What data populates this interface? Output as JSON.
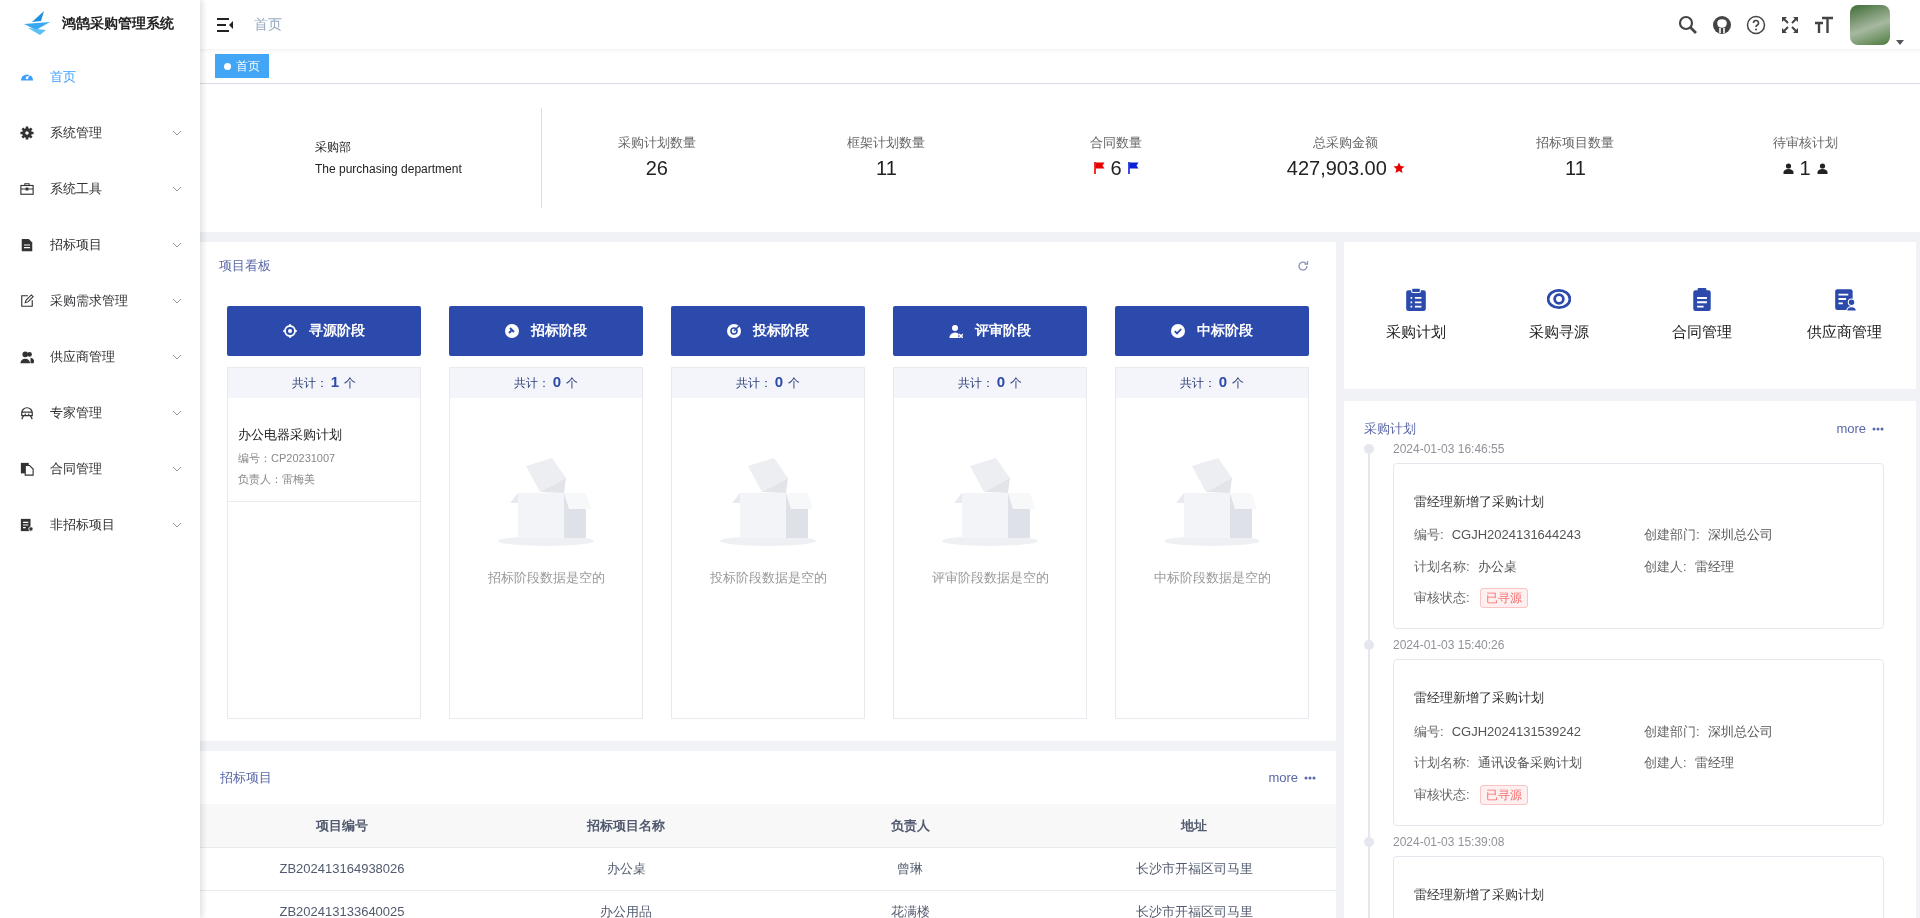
{
  "sidebar": {
    "logo_text": "鸿鹄采购管理系统",
    "items": [
      {
        "label": "首页",
        "selected": true,
        "expandable": false
      },
      {
        "label": "系统管理",
        "selected": false,
        "expandable": true
      },
      {
        "label": "系统工具",
        "selected": false,
        "expandable": true
      },
      {
        "label": "招标项目",
        "selected": false,
        "expandable": true
      },
      {
        "label": "采购需求管理",
        "selected": false,
        "expandable": true
      },
      {
        "label": "供应商管理",
        "selected": false,
        "expandable": true
      },
      {
        "label": "专家管理",
        "selected": false,
        "expandable": true
      },
      {
        "label": "合同管理",
        "selected": false,
        "expandable": true
      },
      {
        "label": "非招标项目",
        "selected": false,
        "expandable": true
      }
    ]
  },
  "header": {
    "breadcrumb": "首页"
  },
  "tags": [
    {
      "label": "首页",
      "selected": true
    }
  ],
  "stats": {
    "department": {
      "title": "采购部",
      "subtitle": "The purchasing department"
    },
    "items": [
      {
        "label": "采购计划数量",
        "value": "26",
        "kind": "plain"
      },
      {
        "label": "框架计划数量",
        "value": "11",
        "kind": "plain"
      },
      {
        "label": "合同数量",
        "value": "6",
        "kind": "flags"
      },
      {
        "label": "总采购金额",
        "value": "427,903.00",
        "kind": "star"
      },
      {
        "label": "招标项目数量",
        "value": "11",
        "kind": "plain"
      },
      {
        "label": "待审核计划",
        "value": "1",
        "kind": "users"
      }
    ]
  },
  "kanban": {
    "title": "项目看板",
    "stages": [
      {
        "title": "寻源阶段",
        "count_label": "共计：",
        "count": "1",
        "unit": "个",
        "items": [
          {
            "name": "办公电器采购计划",
            "code_label": "编号：",
            "code": "CP20231007",
            "owner_label": "负责人：",
            "owner": "雷梅美"
          }
        ]
      },
      {
        "title": "招标阶段",
        "count_label": "共计：",
        "count": "0",
        "unit": "个",
        "empty_text": "招标阶段数据是空的"
      },
      {
        "title": "投标阶段",
        "count_label": "共计：",
        "count": "0",
        "unit": "个",
        "empty_text": "投标阶段数据是空的"
      },
      {
        "title": "评审阶段",
        "count_label": "共计：",
        "count": "0",
        "unit": "个",
        "empty_text": "评审阶段数据是空的"
      },
      {
        "title": "中标阶段",
        "count_label": "共计：",
        "count": "0",
        "unit": "个",
        "empty_text": "中标阶段数据是空的"
      }
    ]
  },
  "shortcuts": [
    {
      "label": "采购计划"
    },
    {
      "label": "采购寻源"
    },
    {
      "label": "合同管理"
    },
    {
      "label": "供应商管理"
    }
  ],
  "plans": {
    "title": "采购计划",
    "more": "more",
    "entries": [
      {
        "time": "2024-01-03 16:46:55",
        "title": "雷经理新增了采购计划",
        "fields": [
          {
            "label": "编号:",
            "value": "CGJH2024131644243"
          },
          {
            "label": "创建部门:",
            "value": "深圳总公司"
          },
          {
            "label": "计划名称:",
            "value": "办公桌"
          },
          {
            "label": "创建人:",
            "value": "雷经理"
          }
        ],
        "status_label": "审核状态:",
        "status": "已寻源"
      },
      {
        "time": "2024-01-03 15:40:26",
        "title": "雷经理新增了采购计划",
        "fields": [
          {
            "label": "编号:",
            "value": "CGJH2024131539242"
          },
          {
            "label": "创建部门:",
            "value": "深圳总公司"
          },
          {
            "label": "计划名称:",
            "value": "通讯设备采购计划"
          },
          {
            "label": "创建人:",
            "value": "雷经理"
          }
        ],
        "status_label": "审核状态:",
        "status": "已寻源"
      },
      {
        "time": "2024-01-03 15:39:08",
        "title": "雷经理新增了采购计划"
      }
    ]
  },
  "bids": {
    "title": "招标项目",
    "more": "more",
    "columns": [
      "项目编号",
      "招标项目名称",
      "负责人",
      "地址"
    ],
    "rows": [
      [
        "ZB202413164938026",
        "办公桌",
        "曾琳",
        "长沙市开福区司马里"
      ],
      [
        "ZB202413133640025",
        "办公用品",
        "花满楼",
        "长沙市开福区司马里"
      ]
    ]
  }
}
